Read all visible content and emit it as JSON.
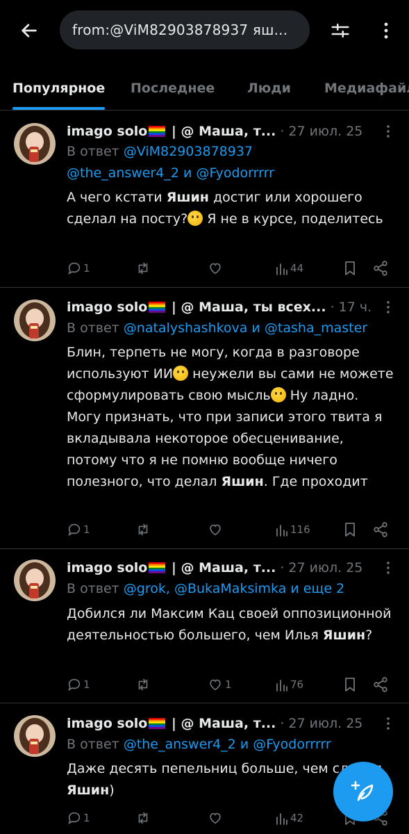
{
  "search": {
    "query": "from:@ViM82903878937 яш..."
  },
  "tabs": [
    "Популярное",
    "Последнее",
    "Люди",
    "Медиафайлы"
  ],
  "active_tab": 0,
  "colors": {
    "accent": "#1d9bf0",
    "background": "#000000",
    "text": "#e7e9ea",
    "muted": "#71767b"
  },
  "tweets": [
    {
      "name": "imago solo",
      "name_rest": " | @ Маша, т...",
      "time": "27 июл. 25",
      "reply_prefix": "В ответ",
      "reply_line1_mention": "@ViM82903878937",
      "reply_line2_m1": "@the_answer4_2",
      "reply_and": "и",
      "reply_line2_m2": "@Fyodorrrrr",
      "text_a": "А чего кстати ",
      "text_bold": "Яшин",
      "text_b": " достиг или хорошего сделал на посту?",
      "text_c": " Я не в курсе, поделитесь",
      "replies": "1",
      "retweets": "",
      "likes": "",
      "views": "44"
    },
    {
      "name": "imago solo",
      "name_rest": " | @ Маша, ты всех...",
      "time": "17 ч.",
      "reply_prefix": "В ответ",
      "reply_m1": "@natalyshashkova",
      "reply_and": "и",
      "reply_m2": "@tasha_master",
      "text_a": "Блин, терпеть не могу, когда в разговоре используют ИИ",
      "text_b": " неужели вы сами не можете сформулировать свою мысль",
      "text_c": " Ну ладно. Могу признать, что при записи этого твита я вкладывала некоторое обесценивание, потому что я не помню вообще ничего полезного, что делал ",
      "text_bold": "Яшин",
      "text_d": ". Где проходит",
      "replies": "1",
      "retweets": "",
      "likes": "",
      "views": "116"
    },
    {
      "name": "imago solo",
      "name_rest": " | @ Маша, т...",
      "time": "27 июл. 25",
      "reply_prefix": "В ответ",
      "reply_m1": "@grok, @BukaMaksimka и еще 2",
      "text_a": "Добился ли Максим Кац своей оппозиционной деятельностью большего, чем Илья ",
      "text_bold": "Яшин",
      "text_b": "?",
      "replies": "1",
      "retweets": "",
      "likes": "1",
      "views": "76"
    },
    {
      "name": "imago solo",
      "name_rest": " | @ Маша, т...",
      "time": "27 июл. 25",
      "reply_prefix": "В ответ",
      "reply_m1": "@the_answer4_2",
      "reply_and": "и",
      "reply_m2": "@Fyodorrrrr",
      "text_a": "Даже десять пепельниц больше, чем сделал ",
      "text_bold": "Яшин",
      "text_b": ")",
      "replies": "1",
      "retweets": "",
      "likes": "",
      "views": "42"
    }
  ]
}
